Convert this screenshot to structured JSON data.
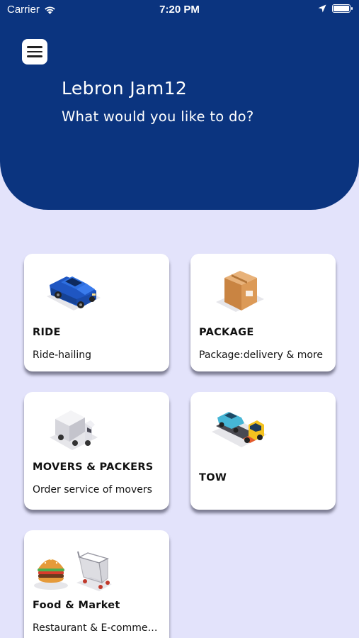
{
  "status_bar": {
    "carrier": "Carrier",
    "time": "7:20 PM"
  },
  "header": {
    "user_name": "Lebron Jam12",
    "prompt": "What would you like to do?",
    "background": "#0b347f"
  },
  "services": [
    {
      "title": "RIDE",
      "subtitle": "Ride-hailing",
      "icon": "blue-car-icon"
    },
    {
      "title": "PACKAGE",
      "subtitle": "Package:delivery & more",
      "icon": "cardboard-box-icon"
    },
    {
      "title": "MOVERS & PACKERS",
      "subtitle": "Order service of movers",
      "icon": "moving-truck-icon"
    },
    {
      "title": "TOW",
      "subtitle": "",
      "icon": "tow-truck-icon"
    },
    {
      "title": "Food & Market",
      "subtitle": "Restaurant & E-comme…",
      "icon": "burger-and-cart-icon"
    }
  ],
  "colors": {
    "page_background": "#e3e3fb",
    "card_background": "#ffffff"
  }
}
